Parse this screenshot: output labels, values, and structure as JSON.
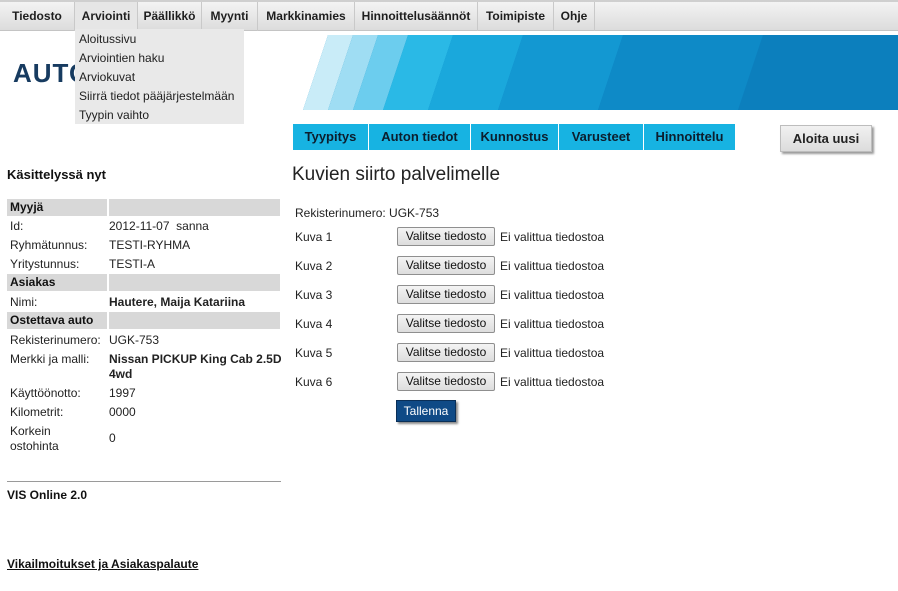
{
  "menu": {
    "items": [
      {
        "label": "Tiedosto"
      },
      {
        "label": "Arviointi"
      },
      {
        "label": "Päällikkö"
      },
      {
        "label": "Myynti"
      },
      {
        "label": "Markkinamies"
      },
      {
        "label": "Hinnoittelusäännöt"
      },
      {
        "label": "Toimipiste"
      },
      {
        "label": "Ohje"
      }
    ],
    "dropdown": [
      {
        "label": "Aloitussivu"
      },
      {
        "label": "Arviointien haku"
      },
      {
        "label": "Arviokuvat"
      },
      {
        "label": "Siirrä tiedot pääjärjestelmään"
      },
      {
        "label": "Tyypin vaihto"
      }
    ]
  },
  "logo": {
    "text": "AUTO"
  },
  "tabs": [
    {
      "label": "Tyypitys"
    },
    {
      "label": "Auton tiedot"
    },
    {
      "label": "Kunnostus"
    },
    {
      "label": "Varusteet"
    },
    {
      "label": "Hinnoittelu"
    }
  ],
  "restart_label": "Aloita uusi",
  "sidebar": {
    "title": "Käsittelyssä nyt",
    "seller": {
      "heading": "Myyjä",
      "id_label": "Id:",
      "id_value": "2012-11-07  sanna",
      "group_label": "Ryhmätunnus:",
      "group_value": "TESTI-RYHMA",
      "company_label": "Yritystunnus:",
      "company_value": "TESTI-A"
    },
    "customer": {
      "heading": "Asiakas",
      "name_label": "Nimi:",
      "name_value": "Hautere, Maija Katariina"
    },
    "car": {
      "heading": "Ostettava auto",
      "reg_label": "Rekisterinumero:",
      "reg_value": "UGK-753",
      "model_label": "Merkki ja malli:",
      "model_value_1": "Nissan PICKUP King Cab 2.5D",
      "model_value_2": "4wd",
      "year_label": "Käyttöönotto:",
      "year_value": "1997",
      "km_label": "Kilometrit:",
      "km_value": "0000",
      "max_label_1": "Korkein",
      "max_label_2": "ostohinta",
      "max_value": "0"
    },
    "version": "VIS Online 2.0",
    "feedback_link": "Vikailmoitukset ja Asiakaspalaute"
  },
  "main": {
    "title": "Kuvien siirto palvelimelle",
    "regno": "Rekisterinumero: UGK-753",
    "images": [
      {
        "label": "Kuva 1",
        "button": "Valitse tiedosto",
        "status": "Ei valittua tiedostoa"
      },
      {
        "label": "Kuva 2",
        "button": "Valitse tiedosto",
        "status": "Ei valittua tiedostoa"
      },
      {
        "label": "Kuva 3",
        "button": "Valitse tiedosto",
        "status": "Ei valittua tiedostoa"
      },
      {
        "label": "Kuva 4",
        "button": "Valitse tiedosto",
        "status": "Ei valittua tiedostoa"
      },
      {
        "label": "Kuva 5",
        "button": "Valitse tiedosto",
        "status": "Ei valittua tiedostoa"
      },
      {
        "label": "Kuva 6",
        "button": "Valitse tiedosto",
        "status": "Ei valittua tiedostoa"
      }
    ],
    "save_label": "Tallenna"
  },
  "colors": {
    "tab": "#17b3e2",
    "save": "#0f4a86",
    "logo": "#173b60"
  }
}
